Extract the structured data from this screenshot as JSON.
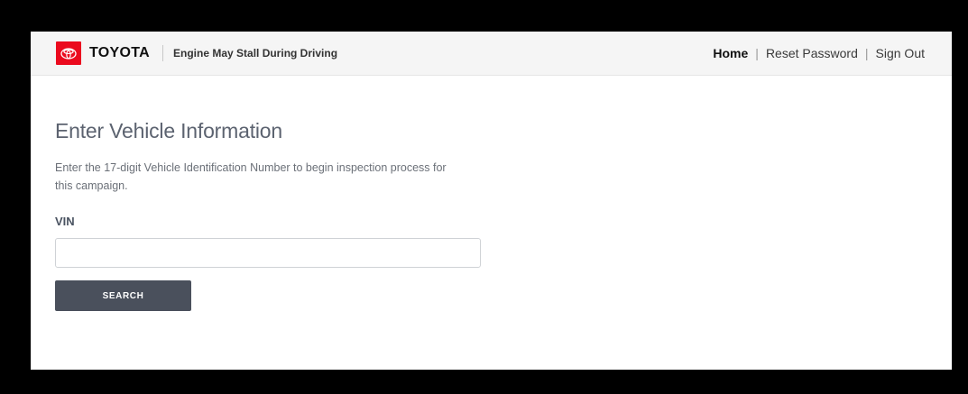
{
  "header": {
    "brand_name": "TOYOTA",
    "campaign_title": "Engine May Stall During Driving",
    "logo_icon": "toyota-logo-icon",
    "brand_color": "#eb0a1e"
  },
  "nav": {
    "home": "Home",
    "sep1": "|",
    "reset_password": "Reset Password",
    "sep2": "|",
    "sign_out": "Sign Out"
  },
  "main": {
    "title": "Enter Vehicle Information",
    "description": "Enter the 17-digit Vehicle Identification Number to begin inspection process for this campaign.",
    "vin_label": "VIN",
    "vin_value": "",
    "vin_placeholder": "",
    "search_label": "SEARCH",
    "button_color": "#4a505c"
  }
}
